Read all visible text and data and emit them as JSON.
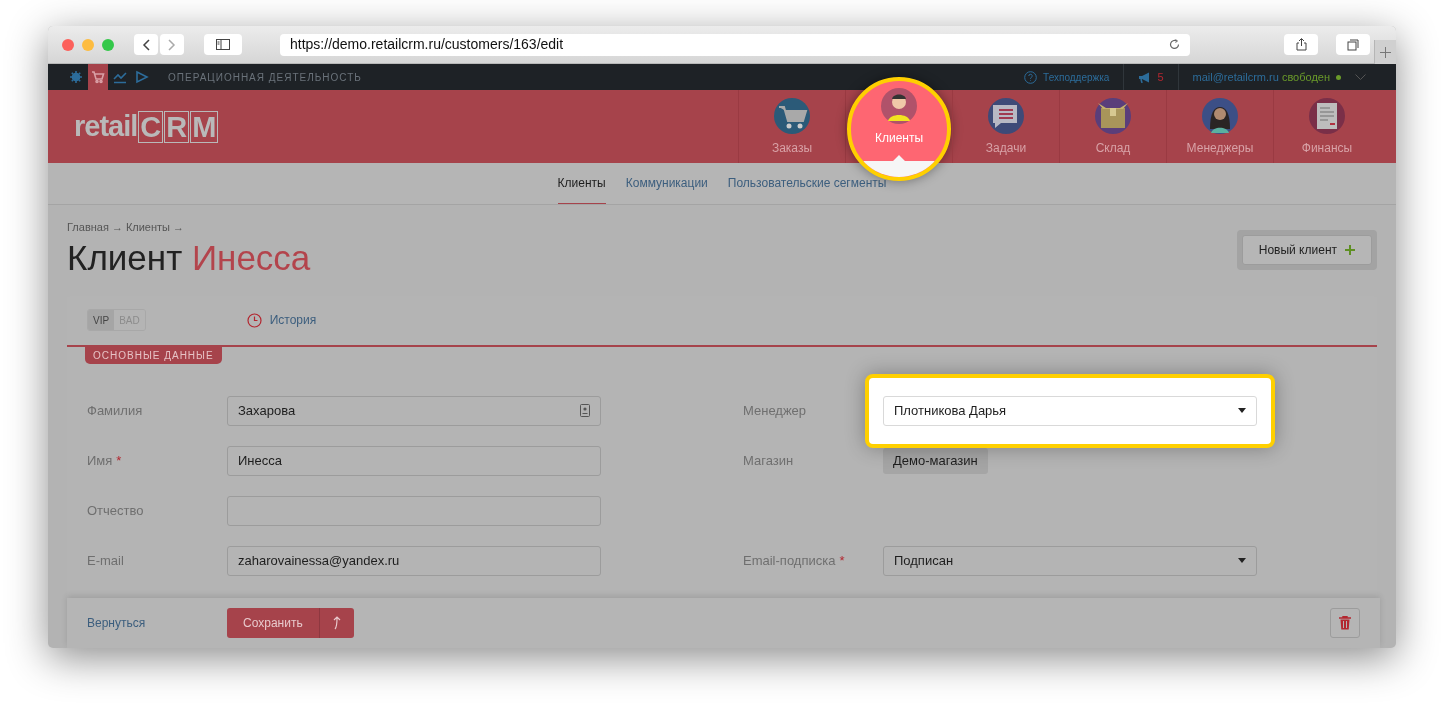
{
  "browser": {
    "url": "https://demo.retailcrm.ru/customers/163/edit"
  },
  "topbar": {
    "tools": [
      {
        "selected": false
      },
      {
        "selected": true
      },
      {
        "selected": false
      },
      {
        "selected": false
      }
    ],
    "section": "ОПЕРАЦИОННАЯ ДЕЯТЕЛЬНОСТЬ",
    "support": "Техподдержка",
    "notifications": "5",
    "email": "mail@retailcrm.ru",
    "status": "свободен"
  },
  "logo": {
    "prefix": "retail",
    "letters": [
      "C",
      "R",
      "M"
    ]
  },
  "nav": [
    {
      "label": "Заказы",
      "selected": false
    },
    {
      "label": "Клиенты",
      "selected": true
    },
    {
      "label": "Задачи",
      "selected": false
    },
    {
      "label": "Склад",
      "selected": false
    },
    {
      "label": "Менеджеры",
      "selected": false
    },
    {
      "label": "Финансы",
      "selected": false
    }
  ],
  "subnav": [
    {
      "label": "Клиенты",
      "selected": true
    },
    {
      "label": "Коммуникации",
      "selected": false
    },
    {
      "label": "Пользовательские сегменты",
      "selected": false
    }
  ],
  "breadcrumb": [
    {
      "label": "Главная",
      "sep": "→"
    },
    {
      "label": "Клиенты",
      "sep": "→"
    }
  ],
  "page_title": {
    "prefix": "Клиент",
    "name": "Инесса"
  },
  "new_button": "Новый клиент",
  "tags": [
    {
      "label": "VIP",
      "selected": true
    },
    {
      "label": "BAD",
      "selected": false
    }
  ],
  "history": "История",
  "required_mark": "*",
  "section_tab": "ОСНОВНЫЕ ДАННЫЕ",
  "rows": [
    {
      "left": {
        "label": "Фамилия",
        "required": false,
        "kind": "contact",
        "value": "Захарова"
      },
      "right": {
        "label": "Менеджер",
        "required": false,
        "kind": "select",
        "value": "Плотникова Дарья",
        "highlighted": true
      }
    },
    {
      "left": {
        "label": "Имя",
        "required": true,
        "kind": "text",
        "value": "Инесса"
      },
      "right": {
        "label": "Магазин",
        "required": false,
        "kind": "chip",
        "value": "Демо-магазин",
        "highlighted": false
      }
    },
    {
      "left": {
        "label": "Отчество",
        "required": false,
        "kind": "text"
      }
    },
    {
      "left": {
        "label": "E-mail",
        "required": false,
        "kind": "text",
        "value": "zaharovainessa@yandex.ru"
      },
      "right": {
        "label": "Email-подписка",
        "required": true,
        "kind": "select",
        "value": "Подписан",
        "highlighted": false
      }
    }
  ],
  "footer": {
    "back": "Вернуться",
    "save": "Сохранить"
  }
}
